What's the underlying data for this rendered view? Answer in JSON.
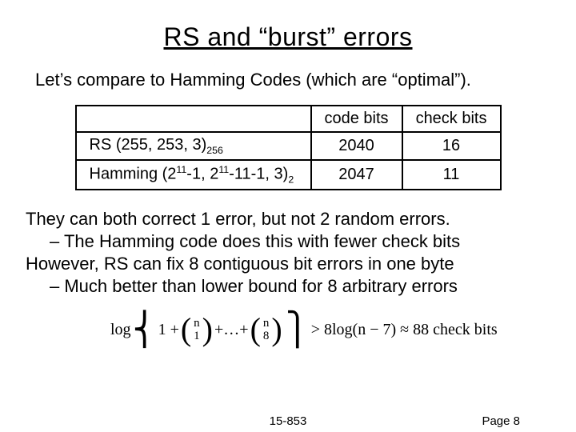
{
  "title": "RS and “burst” errors",
  "intro": "Let’s compare to Hamming Codes (which are “optimal”).",
  "table": {
    "h1": "code bits",
    "h2": "check bits",
    "r1_label_a": "RS (255, 253, 3)",
    "r1_label_sub": "256",
    "r1_c1": "2040",
    "r1_c2": "16",
    "r2_label_a": "Hamming (2",
    "r2_label_b": "-1, 2",
    "r2_label_c": "-11-1, 3)",
    "r2_sup1": "11",
    "r2_sup2": "11",
    "r2_sub": "2",
    "r2_c1": "2047",
    "r2_c2": "11"
  },
  "body": {
    "l1": "They can both correct 1 error, but not 2 random errors.",
    "l1a": "The Hamming code does this with fewer check bits",
    "l2": "However, RS can fix 8 contiguous bit errors in one byte",
    "l2a": "Much better than lower bound for 8 arbitrary errors"
  },
  "formula": {
    "pre": "log",
    "one_plus": "1 +",
    "b1_top": "n",
    "b1_bot": "1",
    "plus": " + ",
    "dots": "…",
    "b2_top": "n",
    "b2_bot": "8",
    "tail": " > 8log(n − 7) ≈ 88 check bits"
  },
  "footer": {
    "center": "15-853",
    "right": "Page 8"
  }
}
